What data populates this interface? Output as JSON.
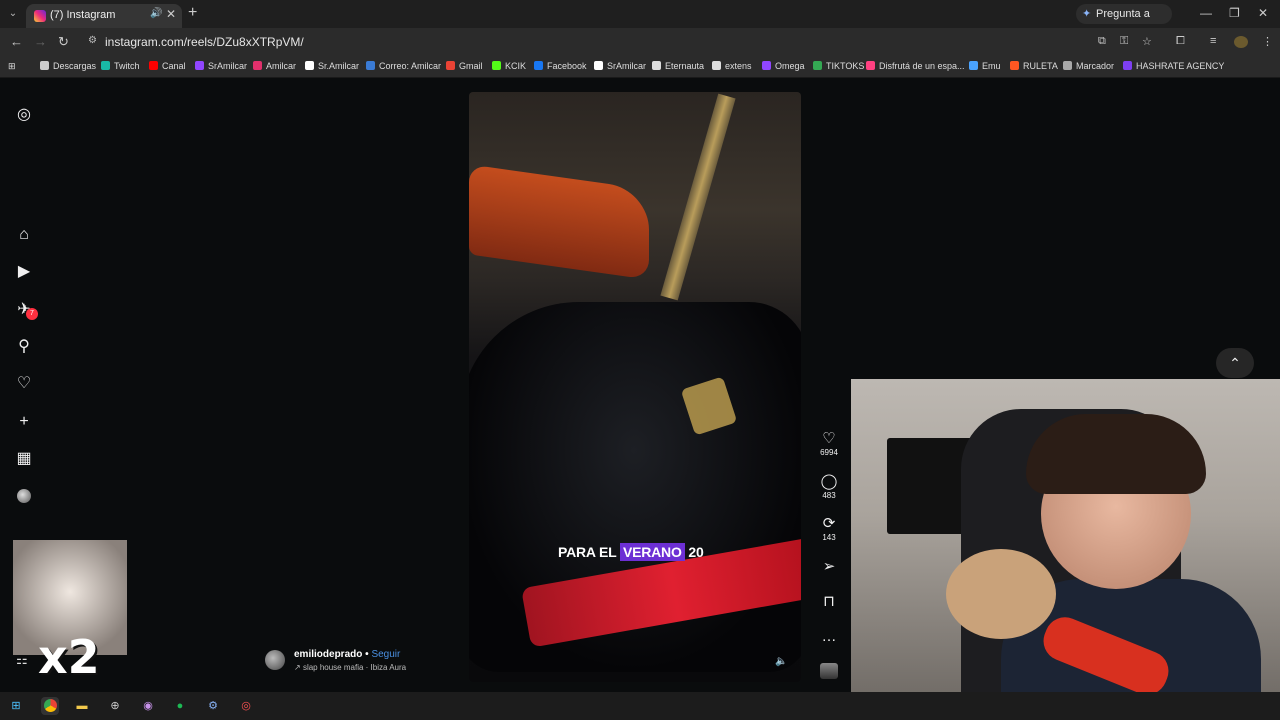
{
  "browser": {
    "tab": {
      "title": "(7) Instagram"
    },
    "gemini_label": "Pregunta a Gemini",
    "url": "instagram.com/reels/DZu8xXTRpVM/",
    "bookmarks": [
      {
        "label": "Descargas",
        "color": "#cccccc"
      },
      {
        "label": "Twitch",
        "color": "#19b8a6"
      },
      {
        "label": "Canal",
        "color": "#ff0000"
      },
      {
        "label": "SrAmilcar",
        "color": "#9146ff"
      },
      {
        "label": "Amilcar",
        "color": "#e1306c"
      },
      {
        "label": "Sr.Amilcar",
        "color": "#ffffff"
      },
      {
        "label": "Correo: Amilcar",
        "color": "#3a7bd5"
      },
      {
        "label": "Gmail",
        "color": "#ea4335"
      },
      {
        "label": "KCIK",
        "color": "#53fc18"
      },
      {
        "label": "Facebook",
        "color": "#1877f2"
      },
      {
        "label": "SrAmilcar",
        "color": "#ffffff"
      },
      {
        "label": "Eternauta",
        "color": "#dddddd"
      },
      {
        "label": "extens",
        "color": "#dddddd"
      },
      {
        "label": "Omega",
        "color": "#9146ff"
      },
      {
        "label": "TIKTOKS",
        "color": "#34a853"
      },
      {
        "label": "Disfrutá de un espa...",
        "color": "#ff4081"
      },
      {
        "label": "Emu",
        "color": "#4aa3ff"
      },
      {
        "label": "RULETA",
        "color": "#ff5722"
      },
      {
        "label": "Marcador",
        "color": "#aaaaaa"
      },
      {
        "label": "HASHRATE AGENCY",
        "color": "#7e3ff2"
      }
    ]
  },
  "sidebar": {
    "notification_count": "7"
  },
  "reel": {
    "caption_plain": "PARA EL",
    "caption_highlight": "VERANO",
    "caption_tail": "20",
    "likes": "6994",
    "comments": "483",
    "reposts": "143",
    "author": "emiliodeprado",
    "separator": "•",
    "follow_label": "Seguir",
    "song": "slap house mafia · Ibiza Aura"
  },
  "overlay": {
    "multiplier": "x2"
  }
}
